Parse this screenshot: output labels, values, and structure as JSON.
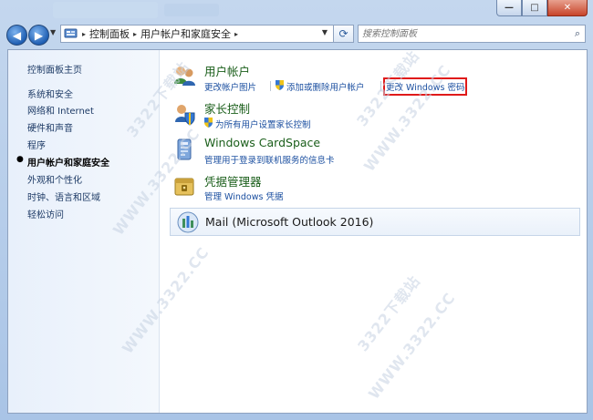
{
  "window": {
    "caption_buttons": [
      "—",
      "□",
      "✕"
    ]
  },
  "navigation": {
    "back_icon": "back-arrow-icon",
    "forward_icon": "forward-arrow-icon",
    "breadcrumbs": [
      "控制面板",
      "用户帐户和家庭安全"
    ],
    "refresh_icon": "refresh-icon",
    "search": {
      "placeholder": "搜索控制面板",
      "icon": "search-icon"
    }
  },
  "sidebar": {
    "items": [
      {
        "label": "控制面板主页",
        "current": false
      },
      {
        "label": "系统和安全",
        "current": false
      },
      {
        "label": "网络和 Internet",
        "current": false
      },
      {
        "label": "硬件和声音",
        "current": false
      },
      {
        "label": "程序",
        "current": false
      },
      {
        "label": "用户帐户和家庭安全",
        "current": true
      },
      {
        "label": "外观和个性化",
        "current": false
      },
      {
        "label": "时钟、语言和区域",
        "current": false
      },
      {
        "label": "轻松访问",
        "current": false
      }
    ]
  },
  "categories": [
    {
      "title": "用户帐户",
      "icon": "user-accounts-icon",
      "links": [
        "更改帐户图片",
        "添加或删除用户帐户",
        "更改 Windows 密码"
      ]
    },
    {
      "title": "家长控制",
      "icon": "parental-controls-icon",
      "links": [
        "为所有用户设置家长控制"
      ]
    },
    {
      "title": "Windows CardSpace",
      "icon": "cardspace-icon",
      "links": [
        "管理用于登录到联机服务的信息卡"
      ]
    },
    {
      "title": "凭据管理器",
      "icon": "credential-manager-icon",
      "links": [
        "管理 Windows 凭据"
      ]
    },
    {
      "title": "Mail (Microsoft Outlook 2016)",
      "icon": "mail-icon",
      "links": []
    }
  ],
  "watermark": {
    "brand": "3322下载站",
    "url": "WWW.3322.CC"
  },
  "colors": {
    "link": "#1b4fa0",
    "category_title": "#1a5e1a",
    "highlight_box": "#e01a1a",
    "frame": "#a9c4e6"
  }
}
